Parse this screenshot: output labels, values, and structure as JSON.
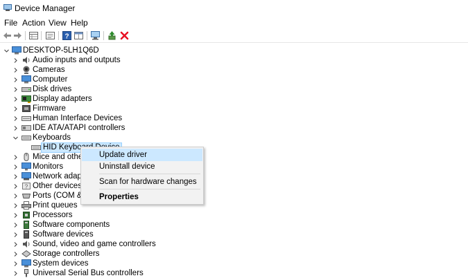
{
  "window": {
    "title": "Device Manager",
    "icon": "device-manager-icon"
  },
  "menu": [
    "File",
    "Action",
    "View",
    "Help"
  ],
  "toolbar": {
    "buttons": [
      "back-icon",
      "forward-icon",
      "properties-grid-icon",
      "show-hide-icon",
      "help-icon",
      "show-icon",
      "monitor-scan-icon",
      "update-driver-icon",
      "uninstall-icon"
    ]
  },
  "tree": {
    "root": "DESKTOP-5LH1Q6D",
    "items": [
      {
        "label": "Audio inputs and outputs",
        "icon": "speaker-icon"
      },
      {
        "label": "Cameras",
        "icon": "camera-icon"
      },
      {
        "label": "Computer",
        "icon": "computer-icon"
      },
      {
        "label": "Disk drives",
        "icon": "disk-drive-icon"
      },
      {
        "label": "Display adapters",
        "icon": "display-adapter-icon"
      },
      {
        "label": "Firmware",
        "icon": "firmware-icon"
      },
      {
        "label": "Human Interface Devices",
        "icon": "hid-icon"
      },
      {
        "label": "IDE ATA/ATAPI controllers",
        "icon": "ide-controller-icon"
      },
      {
        "label": "Keyboards",
        "icon": "keyboard-icon"
      },
      {
        "label": "HID Keyboard Device",
        "icon": "keyboard-icon"
      },
      {
        "label": "Mice and other p",
        "icon": "mouse-icon"
      },
      {
        "label": "Monitors",
        "icon": "monitor-icon"
      },
      {
        "label": "Network adapters",
        "icon": "network-adapter-icon"
      },
      {
        "label": "Other devices",
        "icon": "other-devices-icon"
      },
      {
        "label": "Ports (COM & LP",
        "icon": "ports-icon"
      },
      {
        "label": "Print queues",
        "icon": "printer-icon"
      },
      {
        "label": "Processors",
        "icon": "processor-icon"
      },
      {
        "label": "Software components",
        "icon": "software-component-icon"
      },
      {
        "label": "Software devices",
        "icon": "software-device-icon"
      },
      {
        "label": "Sound, video and game controllers",
        "icon": "sound-controller-icon"
      },
      {
        "label": "Storage controllers",
        "icon": "storage-controller-icon"
      },
      {
        "label": "System devices",
        "icon": "system-devices-icon"
      },
      {
        "label": "Universal Serial Bus controllers",
        "icon": "usb-icon"
      }
    ]
  },
  "context_menu": {
    "items": [
      "Update driver",
      "Uninstall device",
      "Scan for hardware changes",
      "Properties"
    ]
  },
  "colors": {
    "selection": "#cce8ff",
    "selection_border": "#99d1ff",
    "uninstall_red": "#e81123"
  }
}
